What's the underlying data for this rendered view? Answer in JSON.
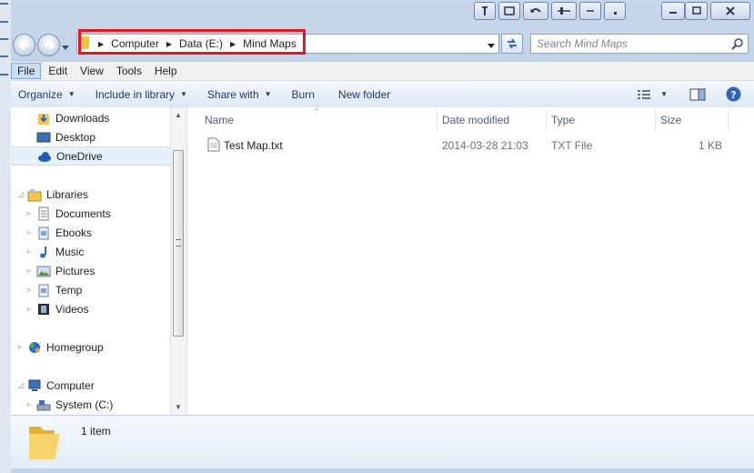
{
  "window": {
    "address_path": [
      "Computer",
      "Data (E:)",
      "Mind Maps"
    ],
    "search_placeholder": "Search Mind Maps"
  },
  "menubar": {
    "items": [
      "File",
      "Edit",
      "View",
      "Tools",
      "Help"
    ]
  },
  "toolbar": {
    "organize": "Organize",
    "include_in_library": "Include in library",
    "share_with": "Share with",
    "burn": "Burn",
    "new_folder": "New folder"
  },
  "navigation": {
    "favorites": [
      "Downloads",
      "Desktop",
      "OneDrive"
    ],
    "libraries_label": "Libraries",
    "libraries": [
      "Documents",
      "Ebooks",
      "Music",
      "Pictures",
      "Temp",
      "Videos"
    ],
    "homegroup": "Homegroup",
    "computer_label": "Computer",
    "drives": [
      "System (C:)"
    ]
  },
  "columns": [
    "Name",
    "Date modified",
    "Type",
    "Size"
  ],
  "files": [
    {
      "name": "Test Map.txt",
      "date_modified": "2014-03-28 21:03",
      "type": "TXT File",
      "size": "1 KB"
    }
  ],
  "details": {
    "count": "1 item"
  },
  "colors": {
    "highlight_box": "#e2171f",
    "selected_nav": "#e5f1fb",
    "frame": "#c3d3e8"
  }
}
